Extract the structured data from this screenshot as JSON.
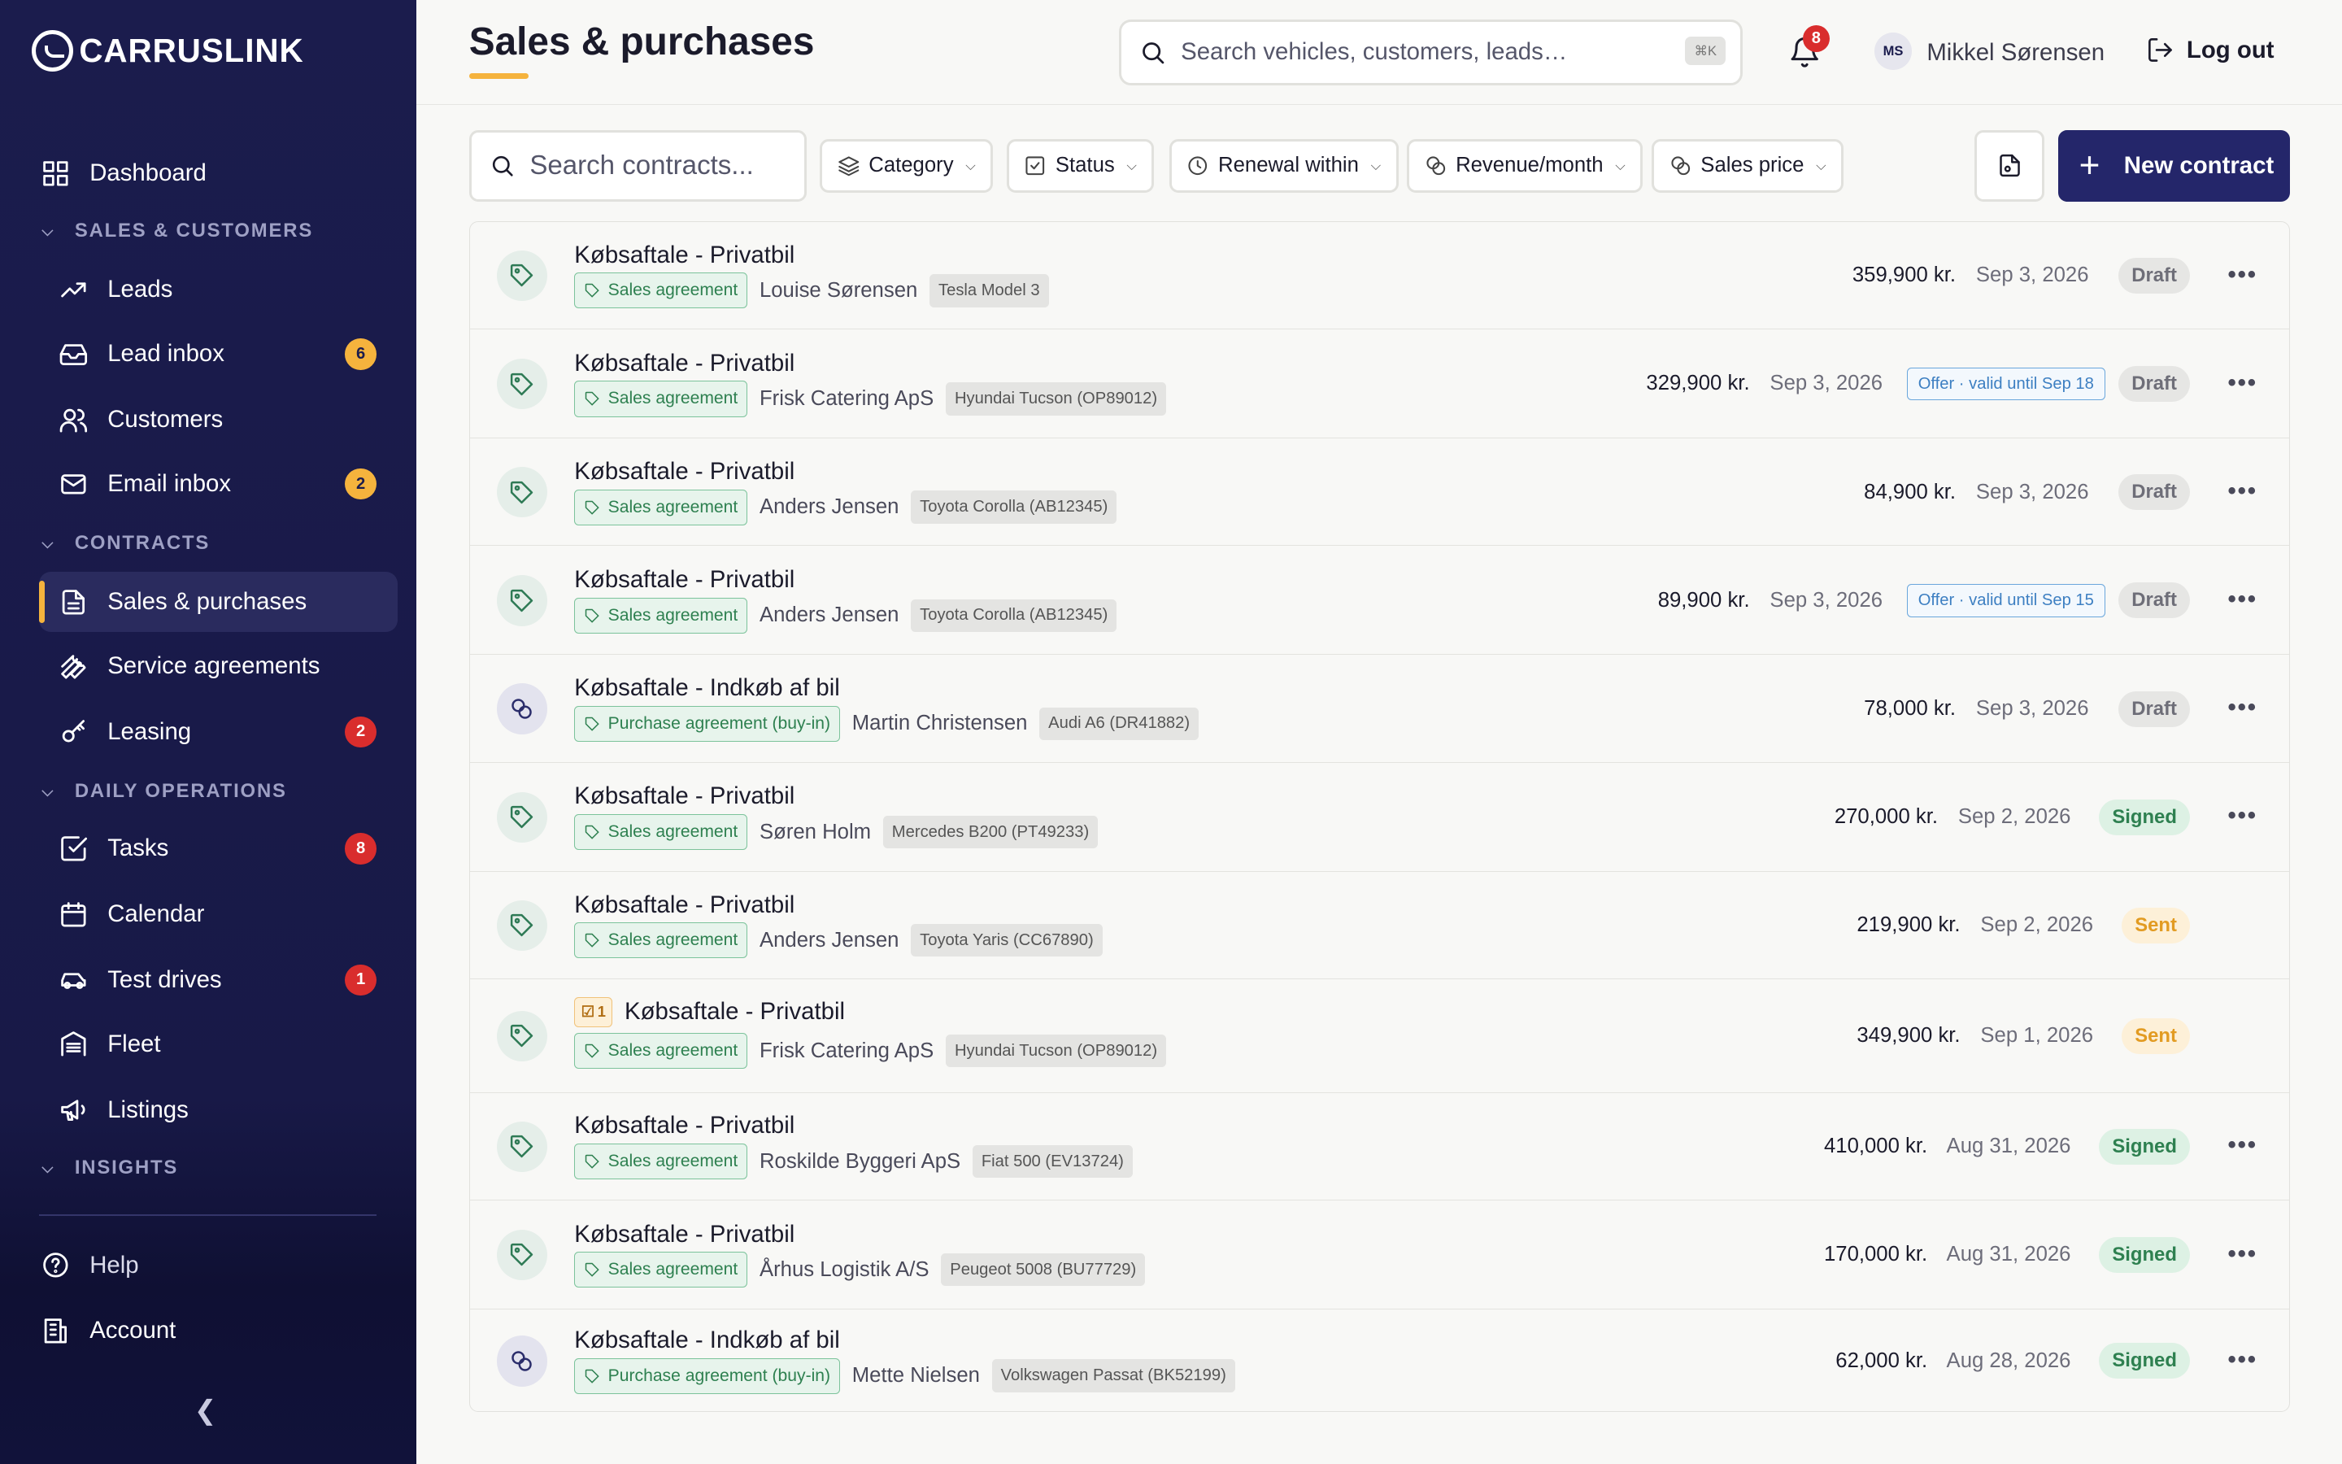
{
  "app": {
    "brand": "CARRUSLINK"
  },
  "header": {
    "title": "Sales & purchases",
    "search_placeholder": "Search vehicles, customers, leads…",
    "search_shortcut": "⌘K",
    "notification_count": "8",
    "user_initials": "MS",
    "user_name": "Mikkel Sørensen",
    "logout_label": "Log out"
  },
  "sidebar": {
    "dashboard": "Dashboard",
    "sections": {
      "sales": "SALES & CUSTOMERS",
      "contracts": "CONTRACTS",
      "daily": "DAILY OPERATIONS",
      "insights": "INSIGHTS"
    },
    "items": {
      "leads": {
        "label": "Leads"
      },
      "lead_inbox": {
        "label": "Lead inbox",
        "badge": "6"
      },
      "customers": {
        "label": "Customers"
      },
      "email_inbox": {
        "label": "Email inbox",
        "badge": "2"
      },
      "sales_purchases": {
        "label": "Sales & purchases"
      },
      "service_agreements": {
        "label": "Service agreements"
      },
      "leasing": {
        "label": "Leasing",
        "badge": "2"
      },
      "tasks": {
        "label": "Tasks",
        "badge": "8"
      },
      "calendar": {
        "label": "Calendar"
      },
      "test_drives": {
        "label": "Test drives",
        "badge": "1"
      },
      "fleet": {
        "label": "Fleet"
      },
      "listings": {
        "label": "Listings"
      }
    },
    "help": "Help",
    "account": "Account"
  },
  "toolbar": {
    "search_placeholder": "Search contracts...",
    "filters": {
      "category": "Category",
      "status": "Status",
      "renewal": "Renewal within",
      "revenue": "Revenue/month",
      "sales_price": "Sales price"
    },
    "new_contract": "New contract"
  },
  "contracts": [
    {
      "icon": "tag-icon",
      "title": "Købsaftale - Privatbil",
      "type": "Sales agreement",
      "customer": "Louise Sørensen",
      "vehicle": "Tesla Model 3",
      "price": "359,900 kr.",
      "date": "Sep 3, 2026",
      "offer": "",
      "status": "Draft",
      "task": ""
    },
    {
      "icon": "tag-icon",
      "title": "Købsaftale - Privatbil",
      "type": "Sales agreement",
      "customer": "Frisk Catering ApS",
      "vehicle": "Hyundai Tucson (OP89012)",
      "price": "329,900 kr.",
      "date": "Sep 3, 2026",
      "offer": "Offer · valid until Sep 18",
      "status": "Draft",
      "task": ""
    },
    {
      "icon": "tag-icon",
      "title": "Købsaftale - Privatbil",
      "type": "Sales agreement",
      "customer": "Anders Jensen",
      "vehicle": "Toyota Corolla (AB12345)",
      "price": "84,900 kr.",
      "date": "Sep 3, 2026",
      "offer": "",
      "status": "Draft",
      "task": ""
    },
    {
      "icon": "tag-icon",
      "title": "Købsaftale - Privatbil",
      "type": "Sales agreement",
      "customer": "Anders Jensen",
      "vehicle": "Toyota Corolla (AB12345)",
      "price": "89,900 kr.",
      "date": "Sep 3, 2026",
      "offer": "Offer · valid until Sep 15",
      "status": "Draft",
      "task": ""
    },
    {
      "icon": "link-icon",
      "title": "Købsaftale - Indkøb af bil",
      "type": "Purchase agreement (buy-in)",
      "customer": "Martin Christensen",
      "vehicle": "Audi A6 (DR41882)",
      "price": "78,000 kr.",
      "date": "Sep 3, 2026",
      "offer": "",
      "status": "Draft",
      "task": ""
    },
    {
      "icon": "tag-icon",
      "title": "Købsaftale - Privatbil",
      "type": "Sales agreement",
      "customer": "Søren Holm",
      "vehicle": "Mercedes B200 (PT49233)",
      "price": "270,000 kr.",
      "date": "Sep 2, 2026",
      "offer": "",
      "status": "Signed",
      "task": ""
    },
    {
      "icon": "tag-icon",
      "title": "Købsaftale - Privatbil",
      "type": "Sales agreement",
      "customer": "Anders Jensen",
      "vehicle": "Toyota Yaris (CC67890)",
      "price": "219,900 kr.",
      "date": "Sep 2, 2026",
      "offer": "",
      "status": "Sent",
      "task": ""
    },
    {
      "icon": "tag-icon",
      "title": "Købsaftale - Privatbil",
      "type": "Sales agreement",
      "customer": "Frisk Catering ApS",
      "vehicle": "Hyundai Tucson (OP89012)",
      "price": "349,900 kr.",
      "date": "Sep 1, 2026",
      "offer": "",
      "status": "Sent",
      "task": "1"
    },
    {
      "icon": "tag-icon",
      "title": "Købsaftale - Privatbil",
      "type": "Sales agreement",
      "customer": "Roskilde Byggeri ApS",
      "vehicle": "Fiat 500 (EV13724)",
      "price": "410,000 kr.",
      "date": "Aug 31, 2026",
      "offer": "",
      "status": "Signed",
      "task": ""
    },
    {
      "icon": "tag-icon",
      "title": "Købsaftale - Privatbil",
      "type": "Sales agreement",
      "customer": "Århus Logistik A/S",
      "vehicle": "Peugeot 5008 (BU77729)",
      "price": "170,000 kr.",
      "date": "Aug 31, 2026",
      "offer": "",
      "status": "Signed",
      "task": ""
    },
    {
      "icon": "link-icon",
      "title": "Købsaftale - Indkøb af bil",
      "type": "Purchase agreement (buy-in)",
      "customer": "Mette Nielsen",
      "vehicle": "Volkswagen Passat (BK52199)",
      "price": "62,000 kr.",
      "date": "Aug 28, 2026",
      "offer": "",
      "status": "Signed",
      "task": ""
    }
  ]
}
